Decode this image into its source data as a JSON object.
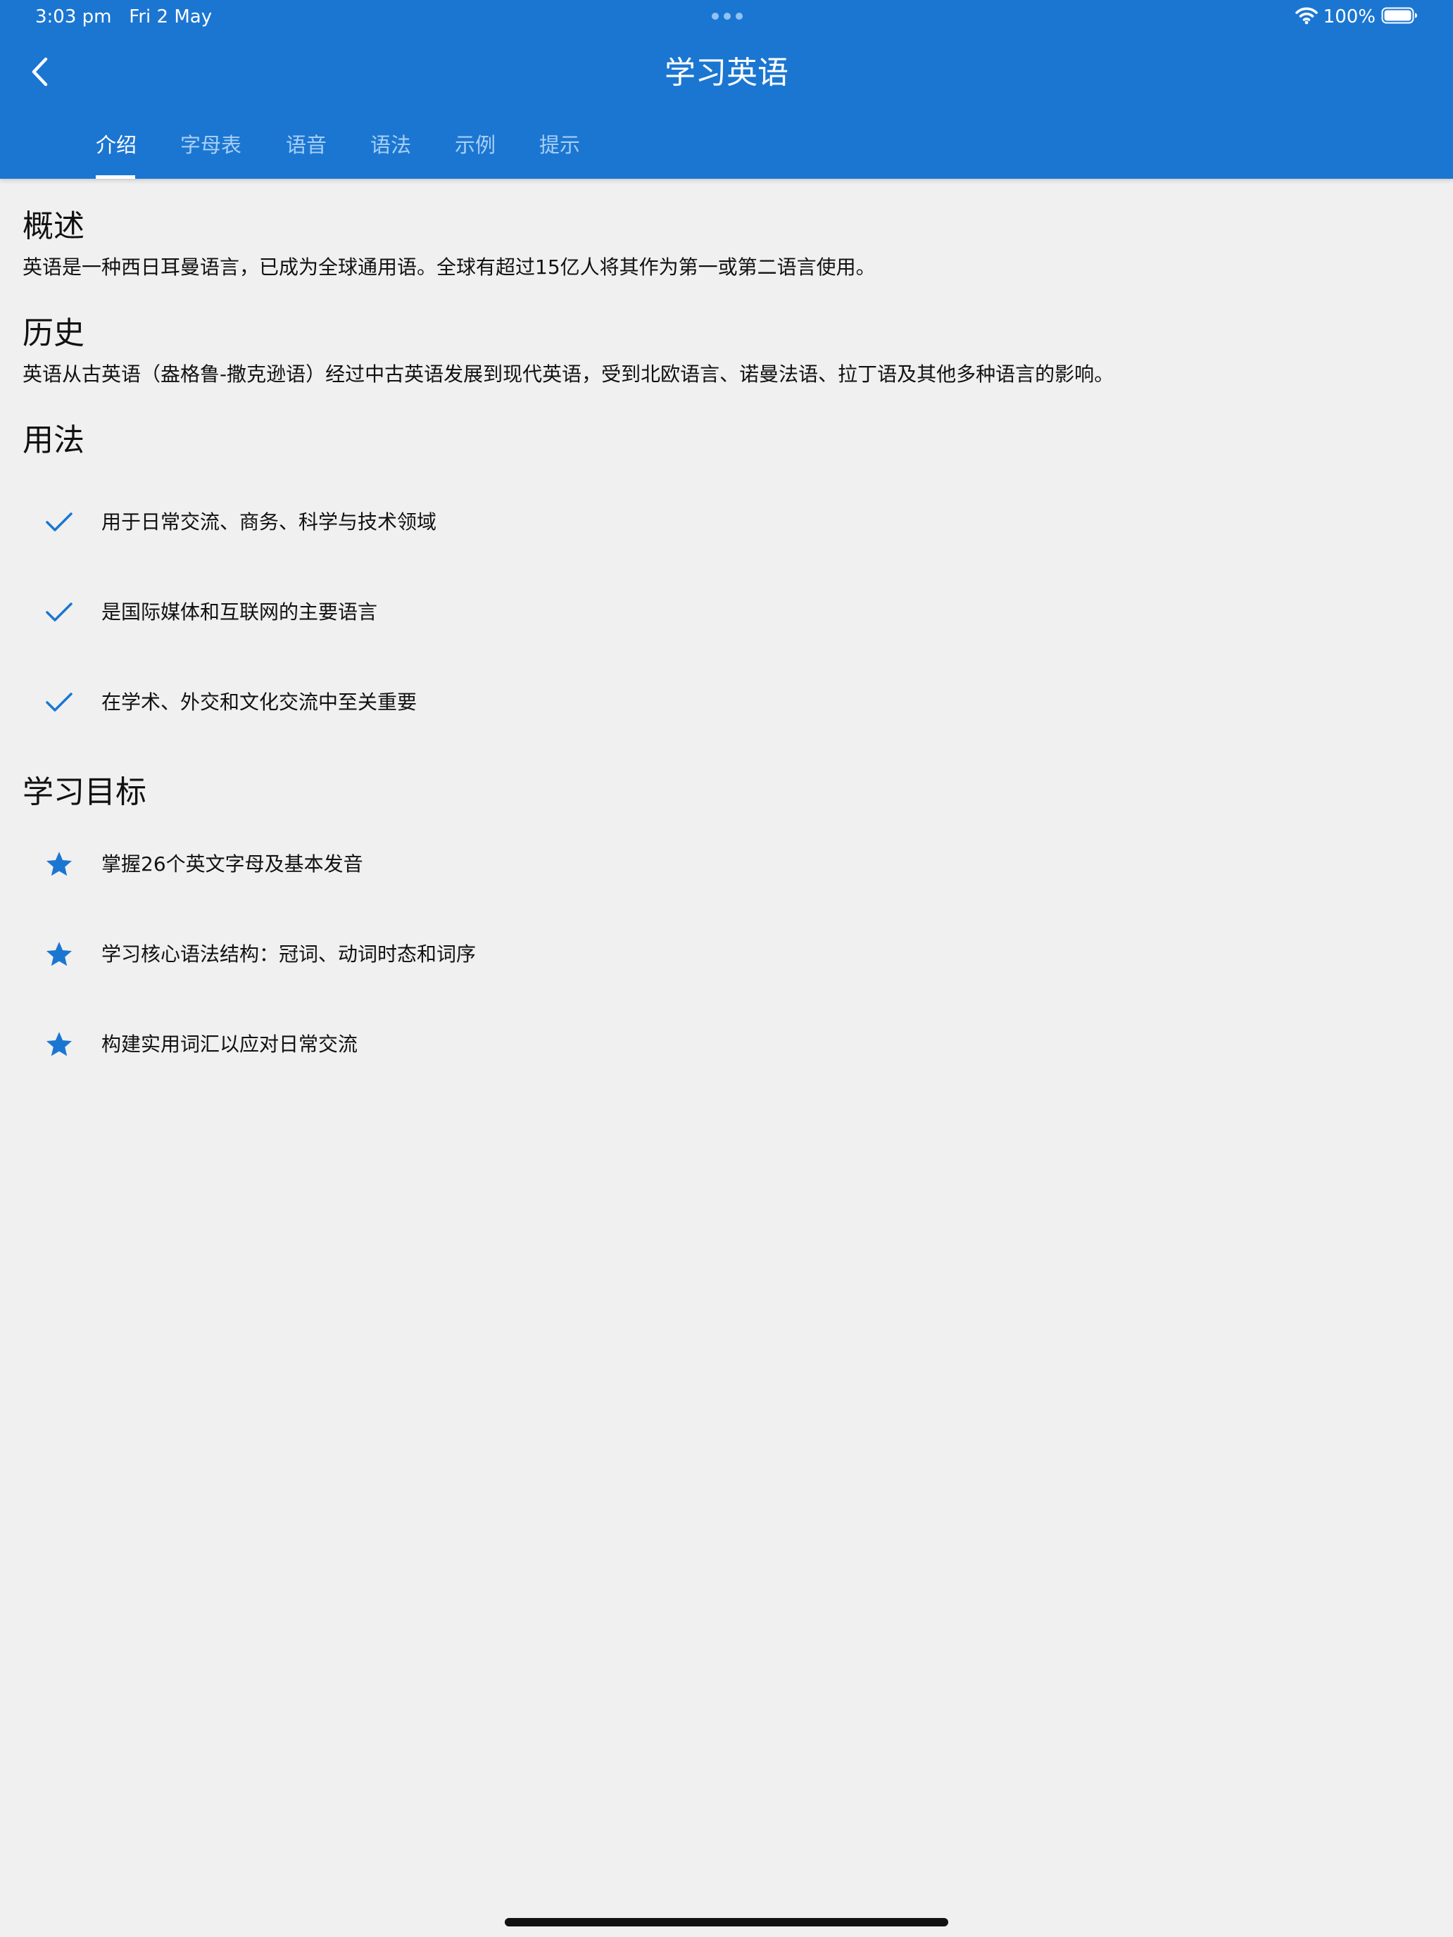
{
  "status_bar": {
    "time": "3:03 pm",
    "date": "Fri 2 May",
    "battery": "100%",
    "icons": [
      "ellipsis-dots-icon",
      "wifi-icon",
      "battery-icon"
    ]
  },
  "nav": {
    "title": "学习英语",
    "back_icon": "chevron-left-icon"
  },
  "tabs": [
    {
      "label": "介绍",
      "active": true
    },
    {
      "label": "字母表",
      "active": false
    },
    {
      "label": "语音",
      "active": false
    },
    {
      "label": "语法",
      "active": false
    },
    {
      "label": "示例",
      "active": false
    },
    {
      "label": "提示",
      "active": false
    }
  ],
  "sections": {
    "overview": {
      "title": "概述",
      "text": "英语是一种西日耳曼语言，已成为全球通用语。全球有超过15亿人将其作为第一或第二语言使用。"
    },
    "history": {
      "title": "历史",
      "text": "英语从古英语（盎格鲁-撒克逊语）经过中古英语发展到现代英语，受到北欧语言、诺曼法语、拉丁语及其他多种语言的影响。"
    },
    "usage": {
      "title": "用法",
      "icon": "checkmark-icon",
      "items": [
        "用于日常交流、商务、科学与技术领域",
        "是国际媒体和互联网的主要语言",
        "在学术、外交和文化交流中至关重要"
      ]
    },
    "goals": {
      "title": "学习目标",
      "icon": "star-icon",
      "items": [
        "掌握26个英文字母及基本发音",
        "学习核心语法结构：冠词、动词时态和词序",
        "构建实用词汇以应对日常交流"
      ]
    }
  },
  "colors": {
    "accent": "#1b76d2",
    "background": "#f0f0f0",
    "tab_inactive": "#a8cff5",
    "text": "#111111"
  }
}
